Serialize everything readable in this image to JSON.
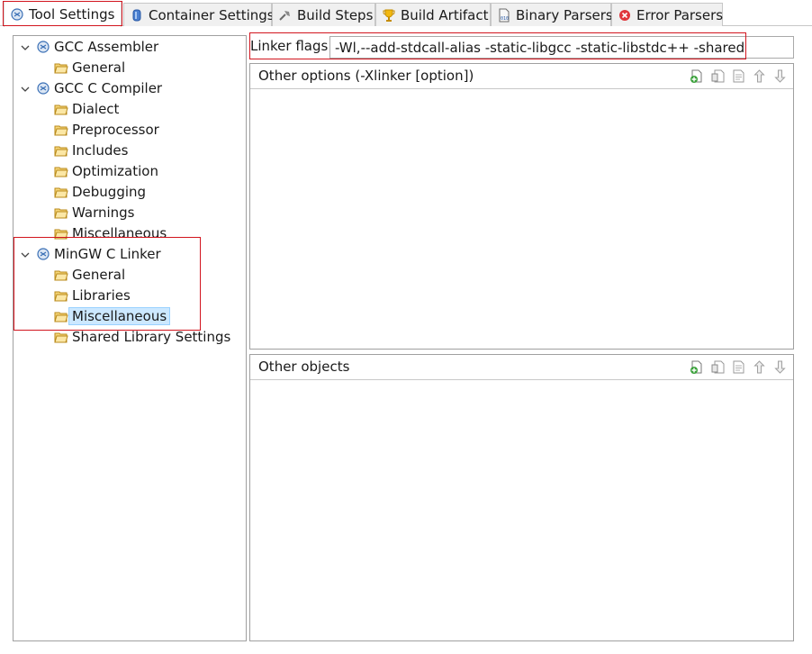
{
  "tabs": [
    {
      "label": "Tool Settings",
      "icon": "tool-settings-icon",
      "active": true
    },
    {
      "label": "Container Settings",
      "icon": "container-icon"
    },
    {
      "label": "Build Steps",
      "icon": "build-steps-icon"
    },
    {
      "label": "Build Artifact",
      "icon": "trophy-icon"
    },
    {
      "label": "Binary Parsers",
      "icon": "binary-parser-icon"
    },
    {
      "label": "Error Parsers",
      "icon": "error-icon"
    }
  ],
  "tree": {
    "assembler": {
      "label": "GCC Assembler",
      "children": [
        "General"
      ]
    },
    "compiler": {
      "label": "GCC C Compiler",
      "children": [
        "Dialect",
        "Preprocessor",
        "Includes",
        "Optimization",
        "Debugging",
        "Warnings",
        "Miscellaneous"
      ]
    },
    "linker": {
      "label": "MinGW C Linker",
      "children": [
        "General",
        "Libraries",
        "Miscellaneous",
        "Shared Library Settings"
      ],
      "selected": "Miscellaneous"
    }
  },
  "linker_flags": {
    "label": "Linker flags",
    "value": "-Wl,--add-stdcall-alias -static-libgcc -static-libstdc++ -shared"
  },
  "other_options": {
    "title": "Other options (-Xlinker [option])",
    "items": []
  },
  "other_objects": {
    "title": "Other objects",
    "items": []
  },
  "list_toolbar": [
    "add-icon",
    "delete-icon",
    "edit-icon",
    "move-up-icon",
    "move-down-icon"
  ],
  "colors": {
    "highlight_box": "#d2151e",
    "selection_bg": "#cce8ff",
    "tree_icon_blue": "#3a6fb5",
    "folder_yellow": "#e6b83c"
  }
}
